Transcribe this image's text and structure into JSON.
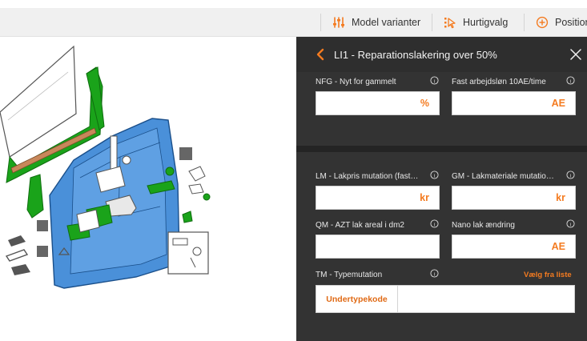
{
  "toolbar": {
    "model_variants_label": "Model varianter",
    "quick_select_label": "Hurtigvalg",
    "position_label": "Position",
    "icon_model_variants": "sliders-icon",
    "icon_quick_select": "quick-select-icon",
    "icon_position": "plus-circle-icon"
  },
  "panel": {
    "title": "LI1 - Reparationslakering over 50%",
    "fields": {
      "nfg": {
        "label": "NFG - Nyt for gammelt",
        "suffix": "%"
      },
      "fast": {
        "label": "Fast arbejdsløn 10AE/time",
        "suffix": "AE"
      },
      "lm": {
        "label": "LM - Lakpris mutation (fast…",
        "suffix": "kr"
      },
      "gm": {
        "label": "GM - Lakmateriale mutatio…",
        "suffix": "kr"
      },
      "qm": {
        "label": "QM - AZT lak areal i dm2",
        "suffix": ""
      },
      "nano": {
        "label": "Nano lak ændring",
        "suffix": "AE"
      },
      "tm": {
        "label": "TM - Typemutation",
        "link": "Vælg fra liste",
        "button": "Undertypekode"
      }
    }
  },
  "colors": {
    "accent": "#f47b20",
    "panel_bg": "#333333",
    "door_blue": "#4a90d9",
    "seal_green": "#1aa31a"
  }
}
